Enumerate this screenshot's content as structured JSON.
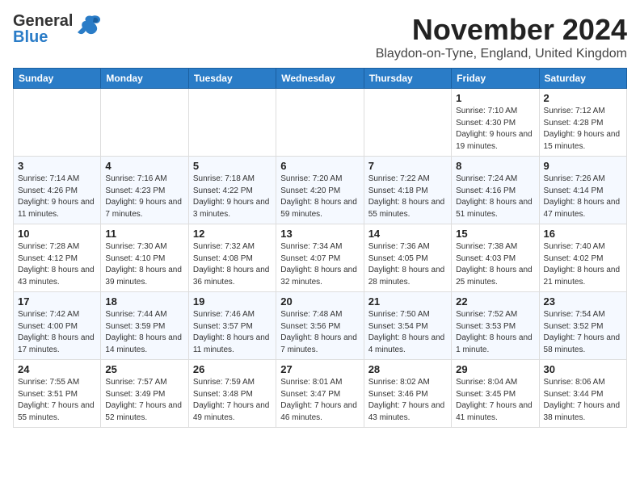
{
  "app": {
    "name_line1": "General",
    "name_line2": "Blue"
  },
  "calendar": {
    "month_title": "November 2024",
    "location": "Blaydon-on-Tyne, England, United Kingdom",
    "days_of_week": [
      "Sunday",
      "Monday",
      "Tuesday",
      "Wednesday",
      "Thursday",
      "Friday",
      "Saturday"
    ],
    "weeks": [
      [
        {
          "day": "",
          "info": ""
        },
        {
          "day": "",
          "info": ""
        },
        {
          "day": "",
          "info": ""
        },
        {
          "day": "",
          "info": ""
        },
        {
          "day": "",
          "info": ""
        },
        {
          "day": "1",
          "info": "Sunrise: 7:10 AM\nSunset: 4:30 PM\nDaylight: 9 hours and 19 minutes."
        },
        {
          "day": "2",
          "info": "Sunrise: 7:12 AM\nSunset: 4:28 PM\nDaylight: 9 hours and 15 minutes."
        }
      ],
      [
        {
          "day": "3",
          "info": "Sunrise: 7:14 AM\nSunset: 4:26 PM\nDaylight: 9 hours and 11 minutes."
        },
        {
          "day": "4",
          "info": "Sunrise: 7:16 AM\nSunset: 4:23 PM\nDaylight: 9 hours and 7 minutes."
        },
        {
          "day": "5",
          "info": "Sunrise: 7:18 AM\nSunset: 4:22 PM\nDaylight: 9 hours and 3 minutes."
        },
        {
          "day": "6",
          "info": "Sunrise: 7:20 AM\nSunset: 4:20 PM\nDaylight: 8 hours and 59 minutes."
        },
        {
          "day": "7",
          "info": "Sunrise: 7:22 AM\nSunset: 4:18 PM\nDaylight: 8 hours and 55 minutes."
        },
        {
          "day": "8",
          "info": "Sunrise: 7:24 AM\nSunset: 4:16 PM\nDaylight: 8 hours and 51 minutes."
        },
        {
          "day": "9",
          "info": "Sunrise: 7:26 AM\nSunset: 4:14 PM\nDaylight: 8 hours and 47 minutes."
        }
      ],
      [
        {
          "day": "10",
          "info": "Sunrise: 7:28 AM\nSunset: 4:12 PM\nDaylight: 8 hours and 43 minutes."
        },
        {
          "day": "11",
          "info": "Sunrise: 7:30 AM\nSunset: 4:10 PM\nDaylight: 8 hours and 39 minutes."
        },
        {
          "day": "12",
          "info": "Sunrise: 7:32 AM\nSunset: 4:08 PM\nDaylight: 8 hours and 36 minutes."
        },
        {
          "day": "13",
          "info": "Sunrise: 7:34 AM\nSunset: 4:07 PM\nDaylight: 8 hours and 32 minutes."
        },
        {
          "day": "14",
          "info": "Sunrise: 7:36 AM\nSunset: 4:05 PM\nDaylight: 8 hours and 28 minutes."
        },
        {
          "day": "15",
          "info": "Sunrise: 7:38 AM\nSunset: 4:03 PM\nDaylight: 8 hours and 25 minutes."
        },
        {
          "day": "16",
          "info": "Sunrise: 7:40 AM\nSunset: 4:02 PM\nDaylight: 8 hours and 21 minutes."
        }
      ],
      [
        {
          "day": "17",
          "info": "Sunrise: 7:42 AM\nSunset: 4:00 PM\nDaylight: 8 hours and 17 minutes."
        },
        {
          "day": "18",
          "info": "Sunrise: 7:44 AM\nSunset: 3:59 PM\nDaylight: 8 hours and 14 minutes."
        },
        {
          "day": "19",
          "info": "Sunrise: 7:46 AM\nSunset: 3:57 PM\nDaylight: 8 hours and 11 minutes."
        },
        {
          "day": "20",
          "info": "Sunrise: 7:48 AM\nSunset: 3:56 PM\nDaylight: 8 hours and 7 minutes."
        },
        {
          "day": "21",
          "info": "Sunrise: 7:50 AM\nSunset: 3:54 PM\nDaylight: 8 hours and 4 minutes."
        },
        {
          "day": "22",
          "info": "Sunrise: 7:52 AM\nSunset: 3:53 PM\nDaylight: 8 hours and 1 minute."
        },
        {
          "day": "23",
          "info": "Sunrise: 7:54 AM\nSunset: 3:52 PM\nDaylight: 7 hours and 58 minutes."
        }
      ],
      [
        {
          "day": "24",
          "info": "Sunrise: 7:55 AM\nSunset: 3:51 PM\nDaylight: 7 hours and 55 minutes."
        },
        {
          "day": "25",
          "info": "Sunrise: 7:57 AM\nSunset: 3:49 PM\nDaylight: 7 hours and 52 minutes."
        },
        {
          "day": "26",
          "info": "Sunrise: 7:59 AM\nSunset: 3:48 PM\nDaylight: 7 hours and 49 minutes."
        },
        {
          "day": "27",
          "info": "Sunrise: 8:01 AM\nSunset: 3:47 PM\nDaylight: 7 hours and 46 minutes."
        },
        {
          "day": "28",
          "info": "Sunrise: 8:02 AM\nSunset: 3:46 PM\nDaylight: 7 hours and 43 minutes."
        },
        {
          "day": "29",
          "info": "Sunrise: 8:04 AM\nSunset: 3:45 PM\nDaylight: 7 hours and 41 minutes."
        },
        {
          "day": "30",
          "info": "Sunrise: 8:06 AM\nSunset: 3:44 PM\nDaylight: 7 hours and 38 minutes."
        }
      ]
    ]
  }
}
